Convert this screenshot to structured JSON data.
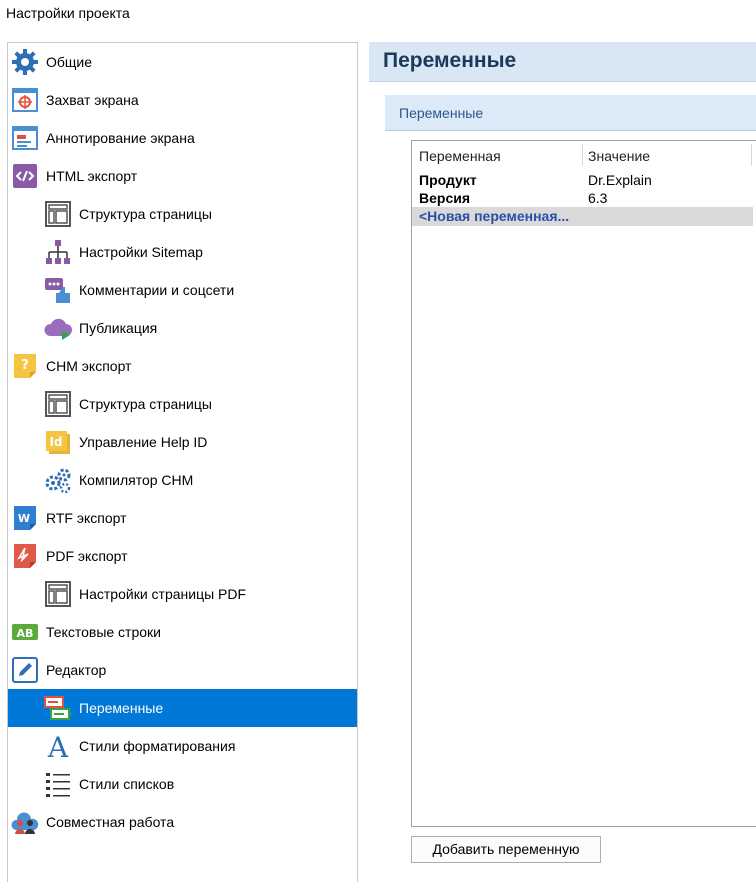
{
  "window": {
    "title": "Настройки проекта"
  },
  "nav": {
    "items": [
      {
        "label": "Общие",
        "icon": "gear-icon"
      },
      {
        "label": "Захват экрана",
        "icon": "screen-capture-icon"
      },
      {
        "label": "Аннотирование экрана",
        "icon": "screen-annotation-icon"
      },
      {
        "label": "HTML экспорт",
        "icon": "html-code-icon"
      },
      {
        "label": "Структура страницы",
        "icon": "page-layout-icon"
      },
      {
        "label": "Настройки Sitemap",
        "icon": "sitemap-icon"
      },
      {
        "label": "Комментарии и соцсети",
        "icon": "comments-like-icon"
      },
      {
        "label": "Публикация",
        "icon": "cloud-publish-icon"
      },
      {
        "label": "CHM экспорт",
        "icon": "chm-help-icon"
      },
      {
        "label": "Структура страницы",
        "icon": "page-layout-icon"
      },
      {
        "label": "Управление Help ID",
        "icon": "help-id-icon"
      },
      {
        "label": "Компилятор CHM",
        "icon": "compiler-gears-icon"
      },
      {
        "label": "RTF экспорт",
        "icon": "rtf-word-icon"
      },
      {
        "label": "PDF экспорт",
        "icon": "pdf-icon"
      },
      {
        "label": "Настройки страницы PDF",
        "icon": "page-layout-icon"
      },
      {
        "label": "Текстовые строки",
        "icon": "text-strings-ab-icon"
      },
      {
        "label": "Редактор",
        "icon": "editor-pen-icon"
      },
      {
        "label": "Переменные",
        "icon": "variables-icon"
      },
      {
        "label": "Стили форматирования",
        "icon": "font-style-icon"
      },
      {
        "label": "Стили списков",
        "icon": "list-style-icon"
      },
      {
        "label": "Совместная работа",
        "icon": "team-cloud-icon"
      }
    ],
    "selected_label": "Переменные"
  },
  "main": {
    "title": "Переменные",
    "section_title": "Переменные",
    "grid": {
      "columns": [
        "Переменная",
        "Значение"
      ],
      "rows": [
        {
          "name": "Продукт",
          "value": "Dr.Explain"
        },
        {
          "name": "Версия",
          "value": "6.3"
        }
      ],
      "new_row_label": "<Новая переменная..."
    },
    "add_button_label": "Добавить переменную"
  },
  "colors": {
    "selection": "#0078d7",
    "header_bg": "#d9e7f5",
    "title_text": "#1a3a5c",
    "new_row_text": "#2a4fa8"
  }
}
